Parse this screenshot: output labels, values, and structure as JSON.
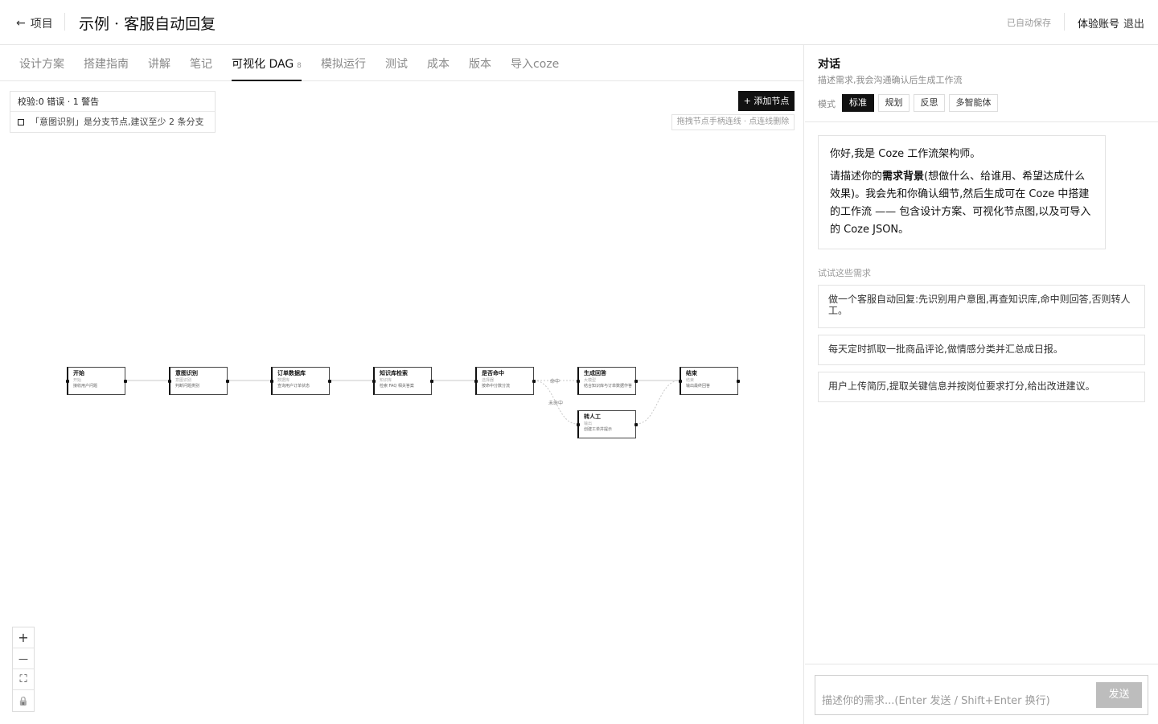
{
  "header": {
    "back_label": "项目",
    "title": "示例 · 客服自动回复",
    "saved_status": "已自动保存",
    "account_label": "体验账号",
    "logout_label": "退出"
  },
  "tabs": [
    {
      "label": "设计方案"
    },
    {
      "label": "搭建指南"
    },
    {
      "label": "讲解"
    },
    {
      "label": "笔记"
    },
    {
      "label": "可视化 DAG",
      "badge": "8",
      "active": true
    },
    {
      "label": "模拟运行"
    },
    {
      "label": "测试"
    },
    {
      "label": "成本"
    },
    {
      "label": "版本"
    },
    {
      "label": "导入coze"
    }
  ],
  "validation": {
    "summary": "校验:0 错误 · 1 警告",
    "warning": "「意图识别」是分支节点,建议至少 2 条分支"
  },
  "toolbar": {
    "add_node_label": "+ 添加节点",
    "hint": "拖拽节点手柄连线 · 点连线删除"
  },
  "dag": {
    "nodes": [
      {
        "id": "start",
        "title": "开始",
        "type": "开始",
        "desc": "接收用户问题"
      },
      {
        "id": "intent",
        "title": "意图识别",
        "type": "意图识别",
        "desc": "判断问题类别"
      },
      {
        "id": "orderdb",
        "title": "订单数据库",
        "type": "数据库",
        "desc": "查询用户订单状态"
      },
      {
        "id": "kb",
        "title": "知识库检索",
        "type": "知识库",
        "desc": "检索 FAQ 相关答案"
      },
      {
        "id": "hit",
        "title": "是否命中",
        "type": "选择器",
        "desc": "按命中分数分流"
      },
      {
        "id": "answer",
        "title": "生成回答",
        "type": "大模型",
        "desc": "结合知识库与订单数据作答"
      },
      {
        "id": "human",
        "title": "转人工",
        "type": "输出",
        "desc": "创建工单并提示"
      },
      {
        "id": "end",
        "title": "结束",
        "type": "结束",
        "desc": "输出最终回答"
      }
    ],
    "edge_labels": {
      "hit": "命中",
      "miss": "未命中"
    }
  },
  "zoom_controls": {
    "zoom_in": "+",
    "zoom_out": "—",
    "fit": "⛶",
    "lock": "🔒"
  },
  "chat": {
    "title": "对话",
    "subtitle": "描述需求,我会沟通确认后生成工作流",
    "mode_label": "模式",
    "modes": [
      "标准",
      "规划",
      "反思",
      "多智能体"
    ],
    "active_mode": "标准",
    "intro_line1": "你好,我是 Coze 工作流架构师。",
    "intro_line2_pre": "请描述你的",
    "intro_line2_bold": "需求背景",
    "intro_line2_post": "(想做什么、给谁用、希望达成什么效果)。我会先和你确认细节,然后生成可在 Coze 中搭建的工作流 —— 包含设计方案、可视化节点图,以及可导入的 Coze JSON。",
    "try_label": "试试这些需求",
    "suggestions": [
      "做一个客服自动回复:先识别用户意图,再查知识库,命中则回答,否则转人工。",
      "每天定时抓取一批商品评论,做情感分类并汇总成日报。",
      "用户上传简历,提取关键信息并按岗位要求打分,给出改进建议。"
    ],
    "input_placeholder": "描述你的需求...(Enter 发送 / Shift+Enter 换行)",
    "send_label": "发送"
  },
  "colors": {
    "accent": "#111111",
    "muted_text": "#8a8a8a",
    "border": "#e3e3e3",
    "send_disabled": "#bdbdbd"
  }
}
